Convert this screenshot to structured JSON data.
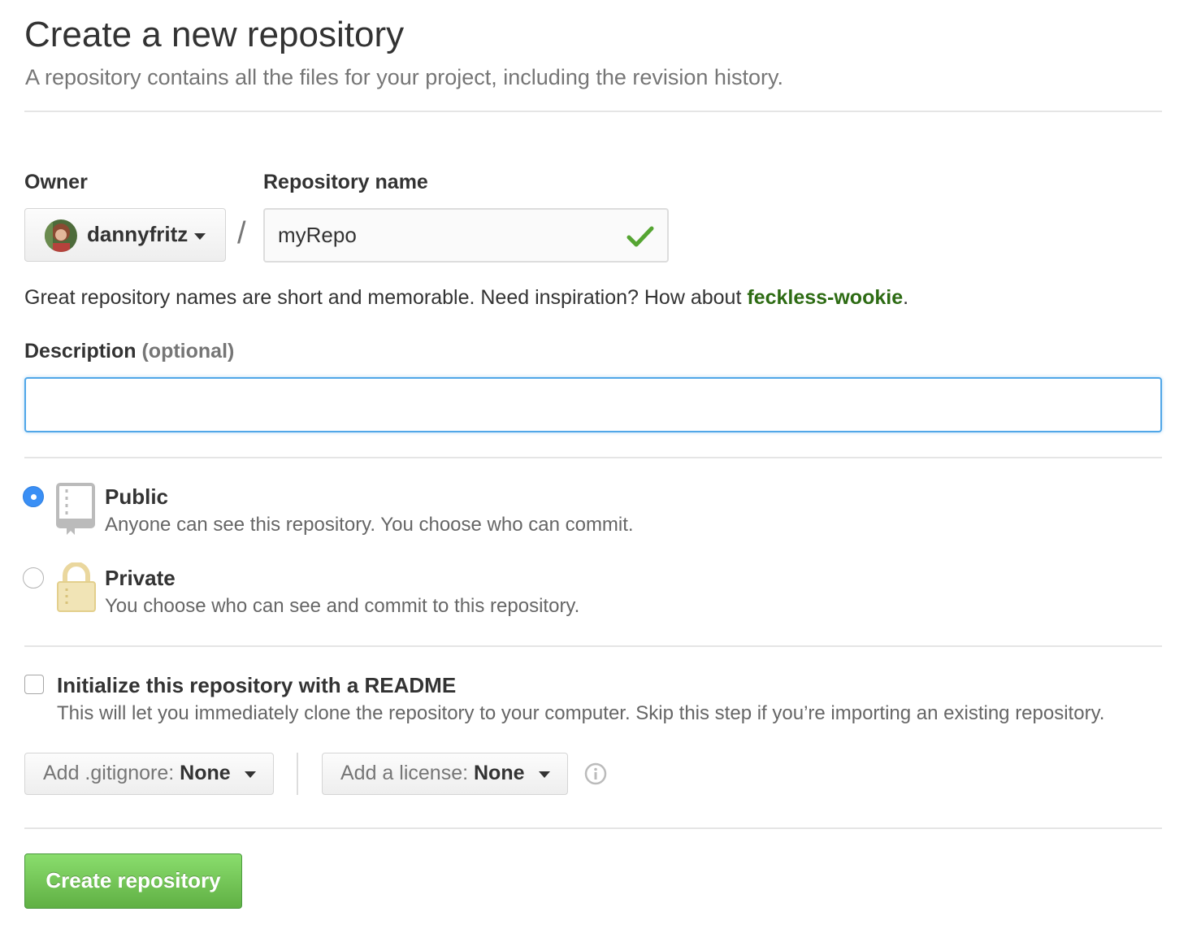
{
  "header": {
    "title": "Create a new repository",
    "subtitle": "A repository contains all the files for your project, including the revision history."
  },
  "owner": {
    "label": "Owner",
    "selected": "dannyfritz"
  },
  "repository_name": {
    "label": "Repository name",
    "value": "myRepo",
    "separator": "/",
    "valid": true
  },
  "name_hint": {
    "text": "Great repository names are short and memorable. Need inspiration? How about ",
    "suggestion": "feckless-wookie",
    "end": "."
  },
  "description": {
    "label": "Description",
    "optional": "(optional)",
    "value": ""
  },
  "visibility": {
    "options": [
      {
        "title": "Public",
        "description": "Anyone can see this repository. You choose who can commit.",
        "selected": true,
        "icon": "repo-book-icon"
      },
      {
        "title": "Private",
        "description": "You choose who can see and commit to this repository.",
        "selected": false,
        "icon": "lock-icon"
      }
    ]
  },
  "init_readme": {
    "title": "Initialize this repository with a README",
    "description": "This will let you immediately clone the repository to your computer. Skip this step if you’re importing an existing repository.",
    "checked": false
  },
  "gitignore": {
    "label": "Add .gitignore: ",
    "value": "None"
  },
  "license": {
    "label": "Add a license: ",
    "value": "None"
  },
  "submit": {
    "label": "Create repository"
  },
  "colors": {
    "primary_button": "#60b044",
    "suggestion": "#2d6b13",
    "focus": "#51a7e8",
    "radio_selected": "#3a8ff5",
    "lock_icon": "#e8d69b"
  }
}
